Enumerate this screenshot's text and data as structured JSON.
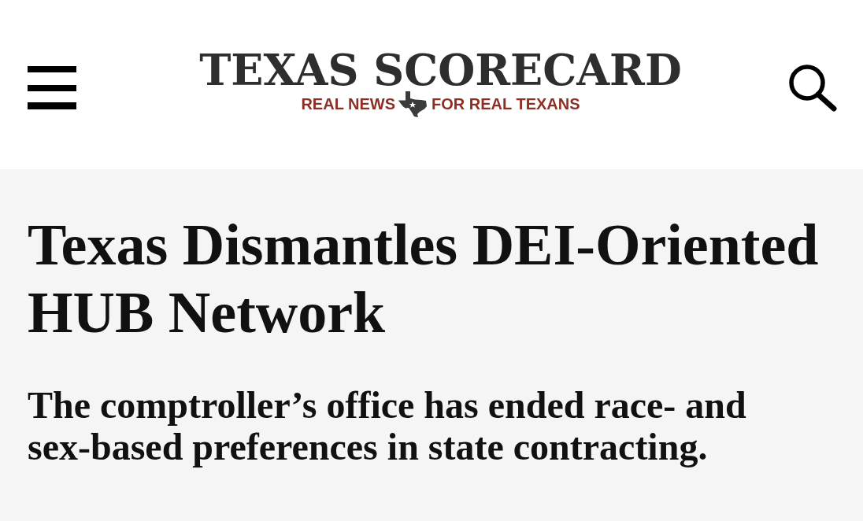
{
  "header": {
    "logo": {
      "name": "TEXAS SCORECARD",
      "tagline_left": "REAL NEWS",
      "tagline_right": "FOR REAL TEXANS"
    }
  },
  "article": {
    "headline": "Texas Dismantles DEI-Oriented HUB Network",
    "subheadline": "The comptroller’s office has ended race- and sex-based preferences in state contracting."
  }
}
